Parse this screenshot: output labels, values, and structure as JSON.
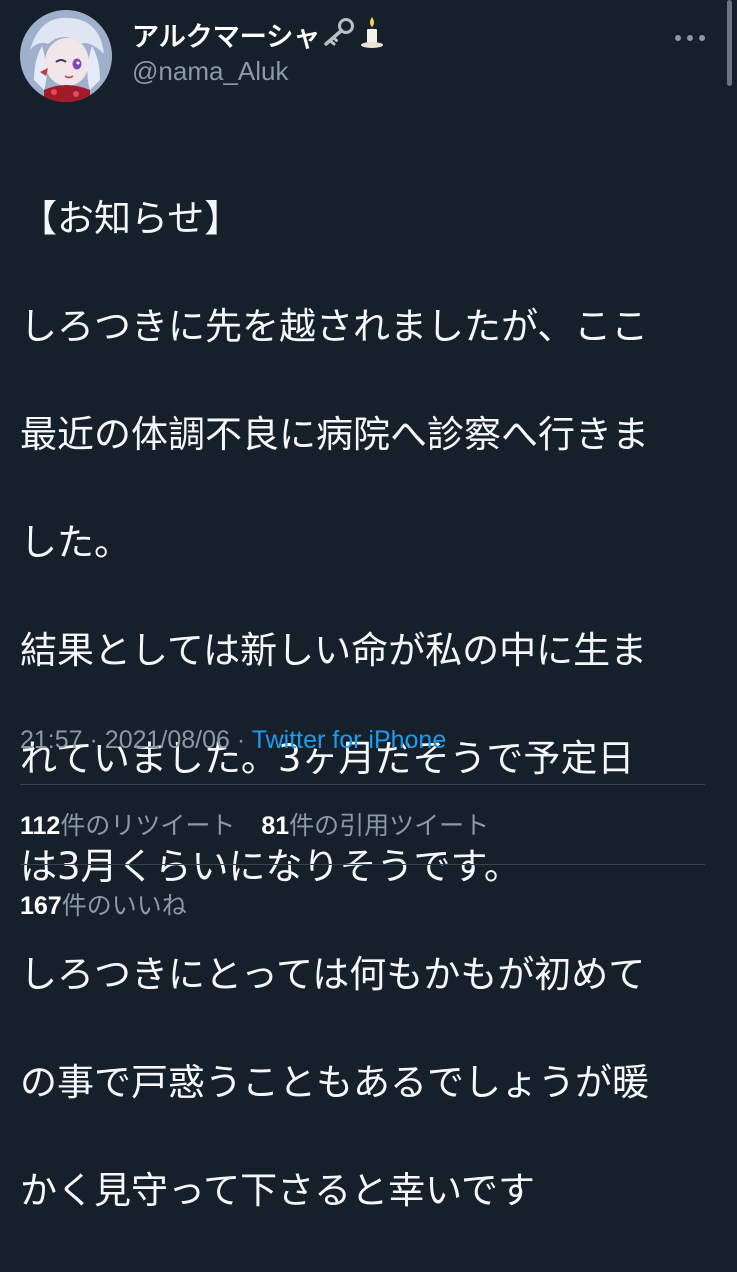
{
  "user": {
    "display_name": "アルクマーシャ",
    "handle": "@nama_Aluk",
    "name_emoji_icons": [
      "key-icon",
      "candle-icon"
    ]
  },
  "tweet": {
    "text": "【お知らせ】\nしろつきに先を越されましたが、ここ最近の体調不良に病院へ診察へ行きました。\n結果としては新しい命が私の中に生まれていました。3ヶ月だそうで予定日は3月くらいになりそうです。\nしろつきにとっては何もかもが初めての事で戸惑うこともあるでしょうが暖かく見守って下さると幸いです",
    "lines": [
      "【お知らせ】",
      "しろつきに先を越されましたが、ここ",
      "最近の体調不良に病院へ診察へ行きま",
      "した。",
      "結果としては新しい命が私の中に生ま",
      "れていました。3ヶ月だそうで予定日",
      "は3月くらいになりそうです。",
      "しろつきにとっては何もかもが初めて",
      "の事で戸惑うこともあるでしょうが暖",
      "かく見守って下さると幸いです"
    ],
    "time": "21:57",
    "date": "2021/08/06",
    "separator": "·",
    "source": "Twitter for iPhone"
  },
  "stats": {
    "retweets_count": "112",
    "retweets_label": "件のリツイート",
    "quotes_count": "81",
    "quotes_label": "件の引用ツイート",
    "likes_count": "167",
    "likes_label": "件のいいね"
  },
  "colors": {
    "background": "#15202b",
    "text": "#ffffff",
    "secondary": "#8b98a5",
    "link": "#1d9bf0",
    "divider": "#38444d"
  },
  "icons": {
    "more": "more-horizontal-icon"
  }
}
